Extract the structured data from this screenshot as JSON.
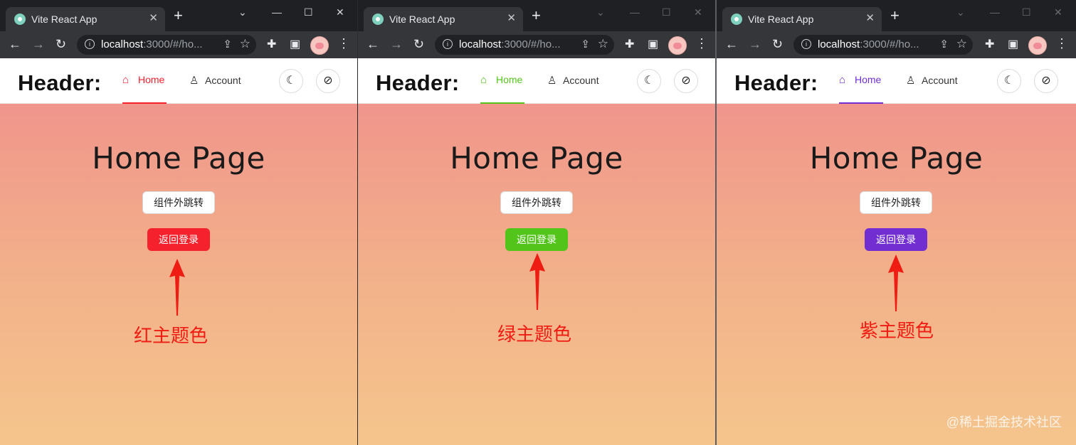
{
  "windows": [
    {
      "tab_title": "Vite React App",
      "url_host": "localhost",
      "url_rest": ":3000/#/ho...",
      "header_title": "Header:",
      "nav": {
        "home": "Home",
        "account": "Account"
      },
      "page_title": "Home Page",
      "jump_button": "组件外跳转",
      "back_button": "返回登录",
      "annotation": "红主题色",
      "accent": "#f5222d"
    },
    {
      "tab_title": "Vite React App",
      "url_host": "localhost",
      "url_rest": ":3000/#/ho...",
      "header_title": "Header:",
      "nav": {
        "home": "Home",
        "account": "Account"
      },
      "page_title": "Home Page",
      "jump_button": "组件外跳转",
      "back_button": "返回登录",
      "annotation": "绿主题色",
      "accent": "#52c41a"
    },
    {
      "tab_title": "Vite React App",
      "url_host": "localhost",
      "url_rest": ":3000/#/ho...",
      "header_title": "Header:",
      "nav": {
        "home": "Home",
        "account": "Account"
      },
      "page_title": "Home Page",
      "jump_button": "组件外跳转",
      "back_button": "返回登录",
      "annotation": "紫主题色",
      "accent": "#722ed1"
    }
  ],
  "watermark": "@稀土掘金技术社区",
  "icons": {
    "tab_favicon": "vite-favicon-icon",
    "tab_close": "close-icon",
    "new_tab": "plus-icon",
    "back": "arrow-left-icon",
    "forward": "arrow-right-icon",
    "reload": "reload-icon",
    "site_info": "info-icon",
    "share": "share-icon",
    "bookmark": "star-icon",
    "extensions": "puzzle-icon",
    "side_panel": "side-panel-icon",
    "profile": "avatar",
    "menu": "kebab-menu-icon",
    "home_nav": "home-icon",
    "account_nav": "user-icon",
    "dark_mode": "moon-icon",
    "theme": "palette-off-icon"
  },
  "annotation_color": "#ee1c13"
}
